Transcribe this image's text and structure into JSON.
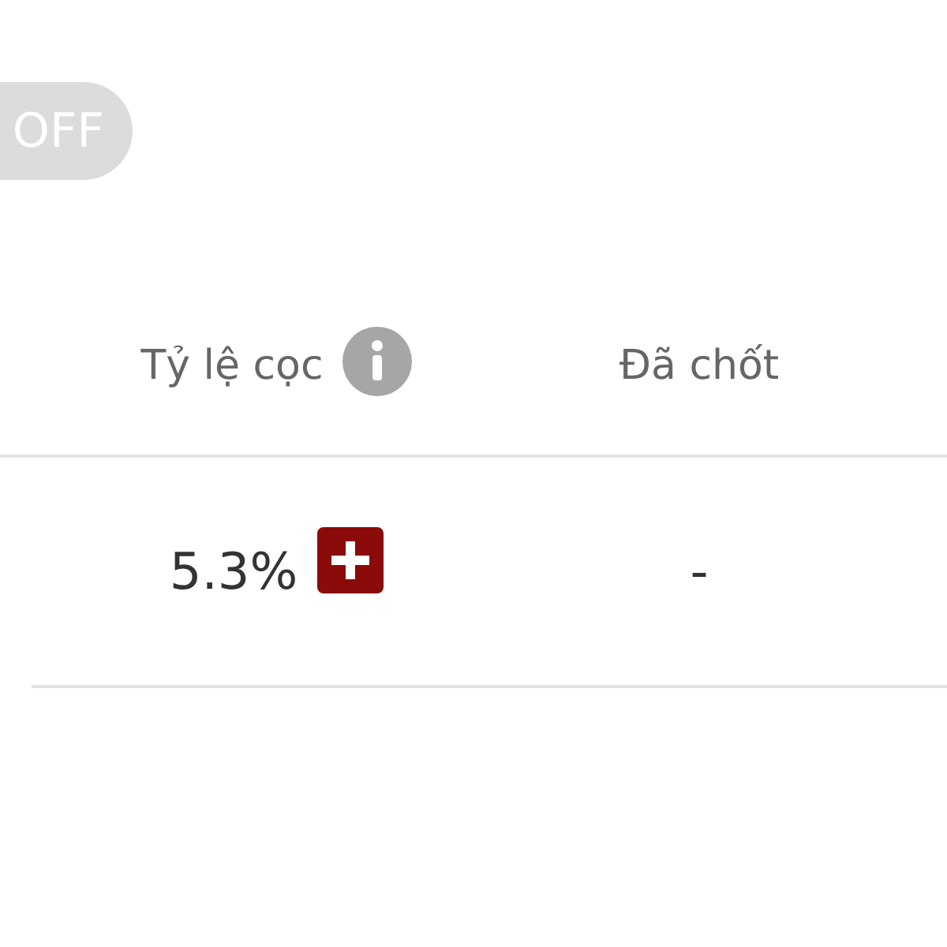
{
  "toggle": {
    "label": "OFF",
    "on": false
  },
  "table": {
    "columns": [
      {
        "label": "Tỷ lệ cọc",
        "info": true
      },
      {
        "label": "Đã chốt",
        "info": false
      }
    ],
    "rows": [
      {
        "cells": [
          {
            "text": "5.3%",
            "expandable": true
          },
          {
            "text": "-",
            "expandable": false
          }
        ]
      }
    ]
  }
}
